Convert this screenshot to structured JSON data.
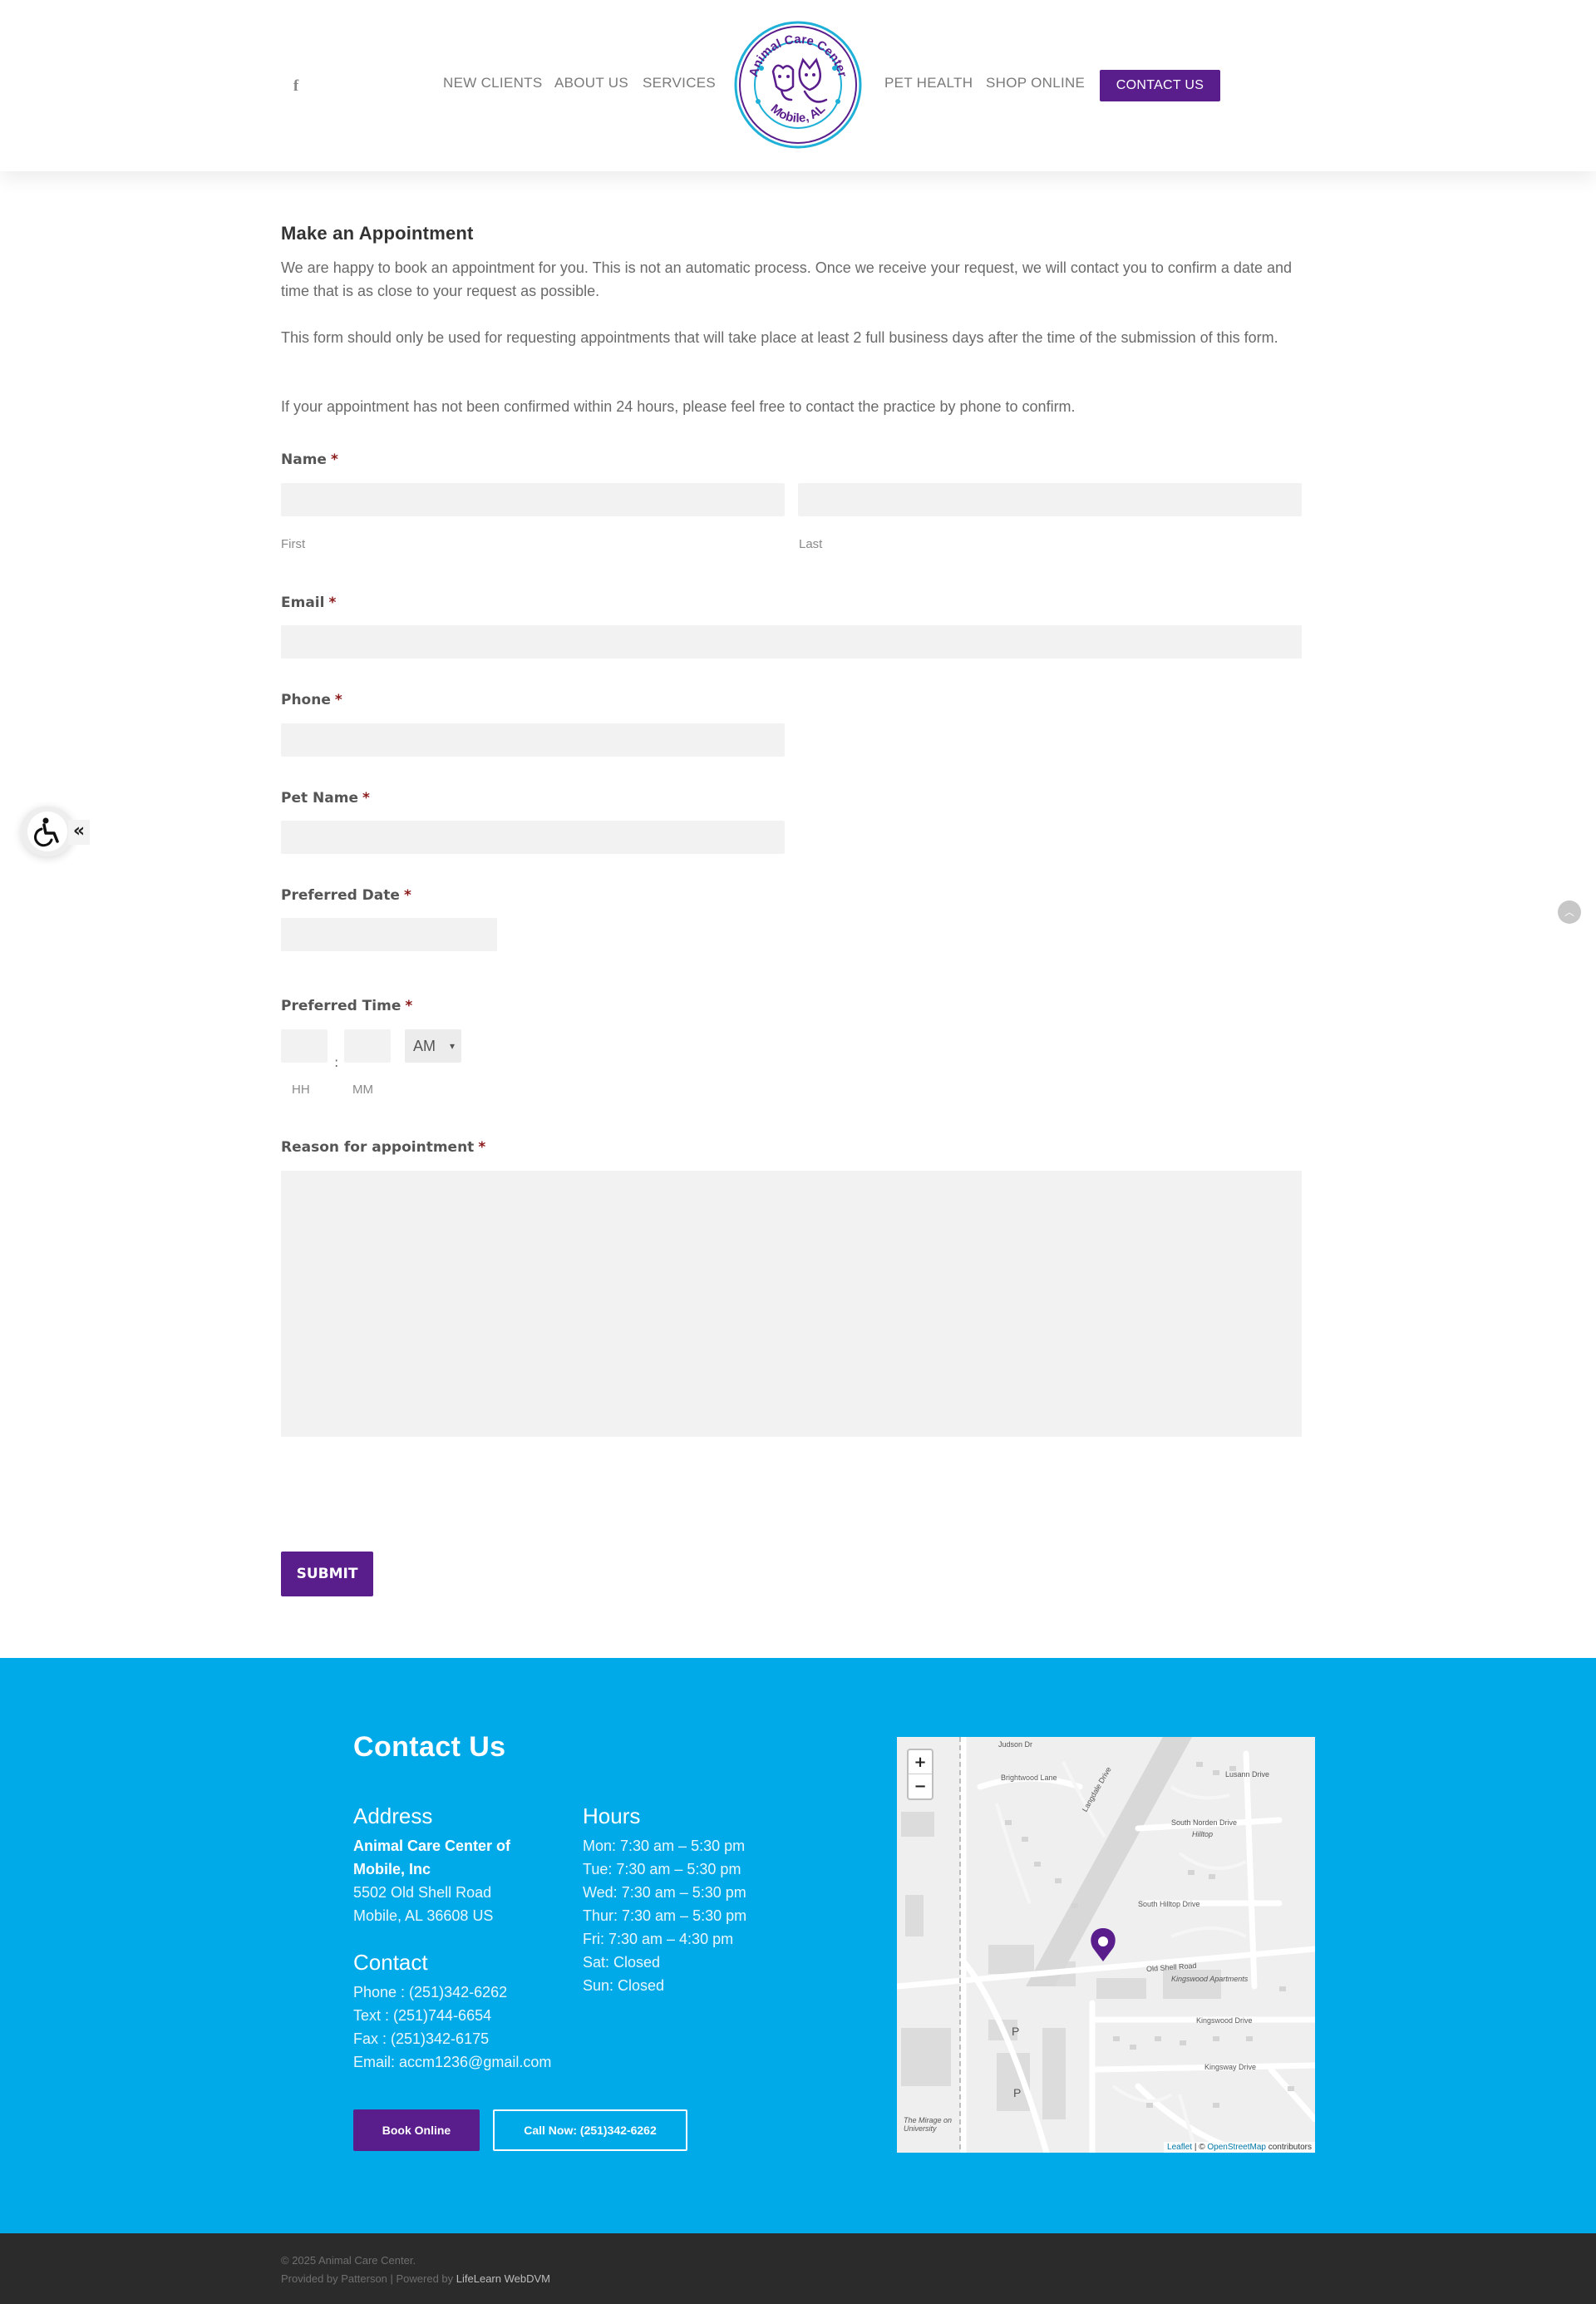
{
  "header": {
    "facebook_icon": "facebook-icon",
    "nav": [
      {
        "label": "NEW CLIENTS"
      },
      {
        "label": "ABOUT US"
      },
      {
        "label": "SERVICES"
      },
      {
        "label": "PET HEALTH"
      },
      {
        "label": "SHOP ONLINE"
      }
    ],
    "contact_button": "CONTACT US",
    "logo": {
      "top_text": "Animal Care Center",
      "bottom_text": "Mobile, AL"
    },
    "accent_color": "#5a1e8c"
  },
  "form": {
    "title": "Make an Appointment",
    "paragraphs": [
      "We are happy to book an appointment for you. This is not an automatic process. Once we receive your request, we will contact you to confirm a date and time that is as close to your request as possible.",
      "This form should only be used for requesting appointments that will take place at least 2 full business days after the time of the submission of this form.",
      "If your appointment has not been confirmed within 24 hours, please feel free to contact the practice by phone to confirm."
    ],
    "required_mark": "*",
    "name_label": "Name",
    "first_sub": "First",
    "last_sub": "Last",
    "email_label": "Email",
    "phone_label": "Phone",
    "pet_name_label": "Pet Name",
    "preferred_date_label": "Preferred Date",
    "preferred_time_label": "Preferred Time",
    "hh_sub": "HH",
    "mm_sub": "MM",
    "colon": ":",
    "ampm_selected": "AM",
    "reason_label": "Reason for appointment",
    "submit_label": "SUBMIT"
  },
  "widgets": {
    "accessibility_icon": "wheelchair-icon",
    "collapse_glyph": "«",
    "scroll_top_icon": "chevron-up-icon"
  },
  "footer": {
    "title": "Contact Us",
    "address_heading": "Address",
    "address_name_1": "Animal Care Center of",
    "address_name_2": "Mobile, Inc",
    "address_line_1": "5502 Old Shell Road",
    "address_line_2": "Mobile, AL 36608  US",
    "contact_heading": "Contact",
    "phone": "Phone : (251)342-6262",
    "text": "Text : (251)744-6654",
    "fax": "Fax : (251)342-6175",
    "email": "Email: accm1236@gmail.com",
    "hours_heading": "Hours",
    "hours": [
      "Mon: 7:30 am – 5:30 pm",
      "Tue: 7:30 am – 5:30 pm",
      "Wed: 7:30 am – 5:30 pm",
      "Thur: 7:30 am – 5:30 pm",
      "Fri: 7:30 am – 4:30 pm",
      "Sat: Closed",
      "Sun: Closed"
    ],
    "book_button": "Book Online",
    "call_button": "Call Now: (251)342-6262",
    "background_color": "#00aae8"
  },
  "map": {
    "zoom_in": "+",
    "zoom_out": "−",
    "attrib_leaflet": "Leaflet",
    "attrib_sep": " | © ",
    "attrib_osm": "OpenStreetMap",
    "attrib_contrib": " contributors",
    "labels": [
      "Judson Dr",
      "Brightwood Lane",
      "Langdale Drive",
      "Lusann Drive",
      "South Norden Drive",
      "Hilltop",
      "South Hilltop Drive",
      "Old Shell Road",
      "Kingswood Apartments",
      "Kingswood Drive",
      "Kingsway Drive",
      "The Mirage on University",
      "P",
      "P"
    ]
  },
  "bottom": {
    "copyright": "© 2025 Animal Care Center.",
    "provided": "Provided by Patterson | Powered by ",
    "lifelearn": "LifeLearn WebDVM"
  }
}
